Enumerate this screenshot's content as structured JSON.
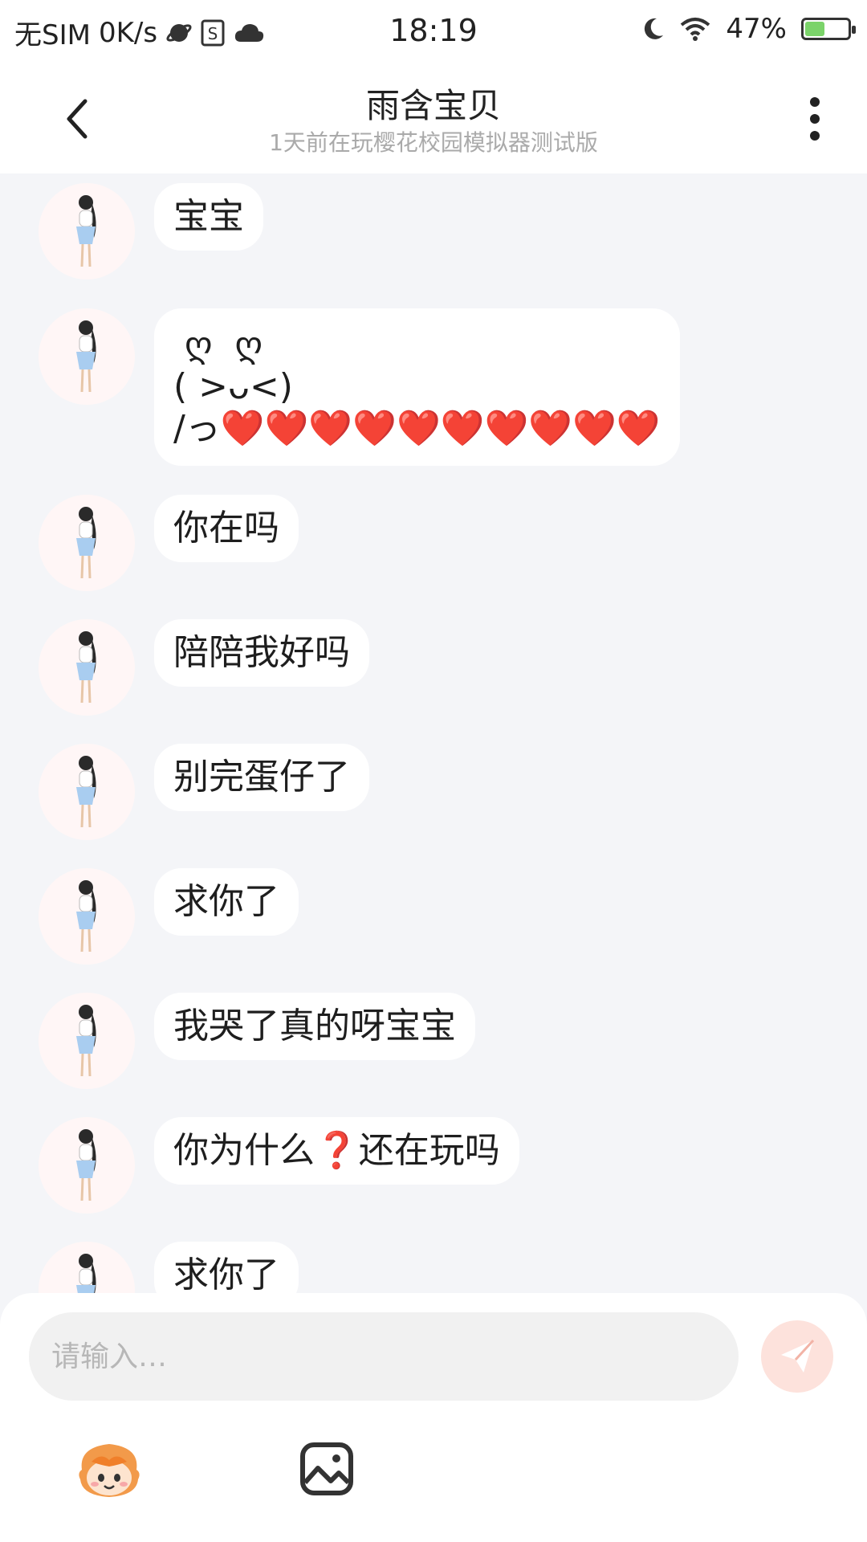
{
  "status_bar": {
    "carrier": "无SIM",
    "speed": "0K/s",
    "time": "18:19",
    "battery": "47%",
    "battery_fraction": 0.47
  },
  "header": {
    "title": "雨含宝贝",
    "subtitle": "1天前在玩樱花校园模拟器测试版"
  },
  "messages": [
    {
      "text": "宝宝"
    },
    {
      "text": " ღ  ღ\n( >ᴗ<)\n/っ❤️❤️❤️❤️❤️❤️❤️❤️❤️❤️"
    },
    {
      "text": "你在吗"
    },
    {
      "text": "陪陪我好吗"
    },
    {
      "text": "别完蛋仔了"
    },
    {
      "text": "求你了"
    },
    {
      "text": "我哭了真的呀宝宝"
    },
    {
      "text": "你为什么❓还在玩吗"
    },
    {
      "text": "求你了"
    }
  ],
  "composer": {
    "placeholder": "请输入…"
  },
  "colors": {
    "background": "#f4f5f8",
    "bubble": "#ffffff",
    "send_button": "#fde2dc",
    "accent": "#f2a99a"
  },
  "icons": {
    "back": "chevron-left-icon",
    "more": "more-vertical-icon",
    "send": "paper-plane-icon",
    "emoji": "emoji-sticker-icon",
    "image": "image-icon"
  }
}
